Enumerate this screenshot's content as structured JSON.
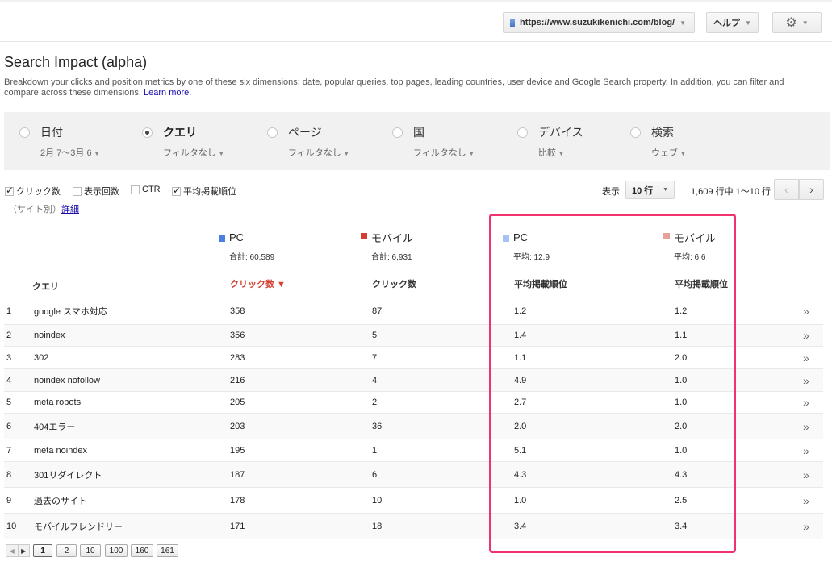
{
  "header": {
    "site_url": "https://www.suzukikenichi.com/blog/",
    "help_label": "ヘルプ"
  },
  "page": {
    "title": "Search Impact (alpha)",
    "description": "Breakdown your clicks and position metrics by one of these six dimensions: date, popular queries, top pages, leading countries, user device and Google Search property. In addition, you can filter and compare across these dimensions.",
    "learn_more": "Learn more."
  },
  "dimensions": [
    {
      "label": "日付",
      "sub": "2月 7〜3月 6",
      "selected": false
    },
    {
      "label": "クエリ",
      "sub": "フィルタなし",
      "selected": true
    },
    {
      "label": "ページ",
      "sub": "フィルタなし",
      "selected": false
    },
    {
      "label": "国",
      "sub": "フィルタなし",
      "selected": false
    },
    {
      "label": "デバイス",
      "sub": "比較",
      "selected": false
    },
    {
      "label": "検索",
      "sub": "ウェブ",
      "selected": false
    }
  ],
  "metrics": [
    {
      "label": "クリック数",
      "checked": true
    },
    {
      "label": "表示回数",
      "checked": false
    },
    {
      "label": "CTR",
      "checked": false
    },
    {
      "label": "平均掲載順位",
      "checked": true
    }
  ],
  "site_note": "（サイト別）",
  "detail_link": "詳細",
  "display": {
    "show_label": "表示",
    "rows_value": "10 行",
    "range_text": "1,609 行中 1〜10 行"
  },
  "groups": {
    "clicks_pc": {
      "name": "PC",
      "sub": "合計: 60,589",
      "color": "#4a7fe6"
    },
    "clicks_mobile": {
      "name": "モバイル",
      "sub": "合計: 6,931",
      "color": "#d23f31"
    },
    "pos_pc": {
      "name": "PC",
      "sub": "平均: 12.9",
      "color": "#a4c2f4"
    },
    "pos_mobile": {
      "name": "モバイル",
      "sub": "平均: 6.6",
      "color": "#e8a09a"
    }
  },
  "columns": {
    "query": "クエリ",
    "clicks_pc": "クリック数 ▼",
    "clicks_mobile": "クリック数",
    "pos_pc": "平均掲載順位",
    "pos_mobile": "平均掲載順位"
  },
  "rows": [
    {
      "n": "1",
      "query": "google スマホ対応",
      "c_pc": "358",
      "c_mob": "87",
      "p_pc": "1.2",
      "p_mob": "1.2"
    },
    {
      "n": "2",
      "query": "noindex",
      "c_pc": "356",
      "c_mob": "5",
      "p_pc": "1.4",
      "p_mob": "1.1"
    },
    {
      "n": "3",
      "query": "302",
      "c_pc": "283",
      "c_mob": "7",
      "p_pc": "1.1",
      "p_mob": "2.0"
    },
    {
      "n": "4",
      "query": "noindex nofollow",
      "c_pc": "216",
      "c_mob": "4",
      "p_pc": "4.9",
      "p_mob": "1.0"
    },
    {
      "n": "5",
      "query": "meta robots",
      "c_pc": "205",
      "c_mob": "2",
      "p_pc": "2.7",
      "p_mob": "1.0"
    },
    {
      "n": "6",
      "query": "404エラー",
      "c_pc": "203",
      "c_mob": "36",
      "p_pc": "2.0",
      "p_mob": "2.0"
    },
    {
      "n": "7",
      "query": "meta noindex",
      "c_pc": "195",
      "c_mob": "1",
      "p_pc": "5.1",
      "p_mob": "1.0"
    },
    {
      "n": "8",
      "query": "301リダイレクト",
      "c_pc": "187",
      "c_mob": "6",
      "p_pc": "4.3",
      "p_mob": "4.3"
    },
    {
      "n": "9",
      "query": "過去のサイト",
      "c_pc": "178",
      "c_mob": "10",
      "p_pc": "1.0",
      "p_mob": "2.5"
    },
    {
      "n": "10",
      "query": "モバイルフレンドリー",
      "c_pc": "171",
      "c_mob": "18",
      "p_pc": "3.4",
      "p_mob": "3.4"
    }
  ],
  "pagination": {
    "pages": [
      "1",
      "2",
      "10",
      "100",
      "160",
      "161"
    ],
    "current": "1"
  }
}
